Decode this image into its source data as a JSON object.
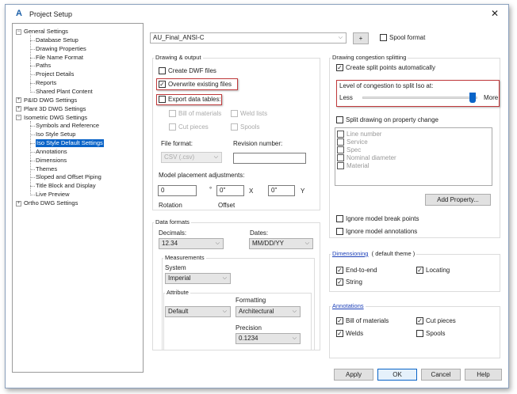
{
  "window": {
    "title": "Project Setup",
    "logo": "A",
    "close": "✕"
  },
  "tree": [
    {
      "label": "General Settings",
      "level": 0,
      "expander": "−"
    },
    {
      "label": "Database Setup",
      "level": 1
    },
    {
      "label": "Drawing Properties",
      "level": 1
    },
    {
      "label": "File Name Format",
      "level": 1
    },
    {
      "label": "Paths",
      "level": 1
    },
    {
      "label": "Project Details",
      "level": 1
    },
    {
      "label": "Reports",
      "level": 1
    },
    {
      "label": "Shared Plant Content",
      "level": 1
    },
    {
      "label": "P&ID DWG Settings",
      "level": 0,
      "expander": "+"
    },
    {
      "label": "Plant 3D DWG Settings",
      "level": 0,
      "expander": "+"
    },
    {
      "label": "Isometric DWG Settings",
      "level": 0,
      "expander": "−"
    },
    {
      "label": "Symbols and Reference",
      "level": 1
    },
    {
      "label": "Iso Style Setup",
      "level": 1
    },
    {
      "label": "Iso Style Default Settings",
      "level": 1,
      "selected": true
    },
    {
      "label": "Annotations",
      "level": 1
    },
    {
      "label": "Dimensions",
      "level": 1
    },
    {
      "label": "Themes",
      "level": 1
    },
    {
      "label": "Sloped and Offset Piping",
      "level": 1
    },
    {
      "label": "Title Block and Display",
      "level": 1
    },
    {
      "label": "Live Preview",
      "level": 1
    },
    {
      "label": "Ortho DWG Settings",
      "level": 0,
      "expander": "+"
    }
  ],
  "top": {
    "style": "AU_Final_ANSI-C",
    "plus": "+",
    "spool_format": "Spool format"
  },
  "drawing_output": {
    "title": "Drawing & output",
    "create_dwf": "Create DWF files",
    "overwrite": "Overwrite existing files",
    "export": "Export data tables:",
    "bom": "Bill of materials",
    "weld_lists": "Weld lists",
    "cut_pieces": "Cut pieces",
    "spools": "Spools",
    "file_format_label": "File format:",
    "file_format": "CSV (.csv)",
    "revision_label": "Revision number:",
    "revision": "",
    "model_label": "Model placement adjustments:",
    "rotation": "0",
    "deg": "°",
    "offset_x": "0\"",
    "x": "X",
    "offset_y": "0\"",
    "y": "Y",
    "rotation_label": "Rotation",
    "offset_label": "Offset"
  },
  "data_formats": {
    "title": "Data formats",
    "decimals_label": "Decimals:",
    "decimals": "12.34",
    "dates_label": "Dates:",
    "dates": "MM/DD/YY",
    "measurements": "Measurements",
    "system_label": "System",
    "system": "Imperial",
    "attribute": "Attribute",
    "attr_value": "Default",
    "formatting_label": "Formatting",
    "formatting": "Architectural",
    "precision_label": "Precision",
    "precision": "0.1234"
  },
  "congestion": {
    "title": "Drawing congestion splitting",
    "create_split": "Create split points automatically",
    "level_label": "Level of congestion to split Iso at:",
    "less": "Less",
    "more": "More",
    "level_value": 0.95,
    "split_property": "Split drawing on property change",
    "properties": [
      "Line number",
      "Service",
      "Spec",
      "Nominal diameter",
      "Material"
    ],
    "add_property": "Add Property...",
    "ignore_break": "Ignore model break points",
    "ignore_annotations": "Ignore model annotations"
  },
  "dimensioning": {
    "title": "Dimensioning",
    "theme": "( default theme )",
    "end_to_end": "End-to-end",
    "locating": "Locating",
    "string": "String"
  },
  "annotations": {
    "title": "Annotations",
    "bom": "Bill of materials",
    "cut_pieces": "Cut pieces",
    "welds": "Welds",
    "spools": "Spools"
  },
  "buttons": {
    "apply": "Apply",
    "ok": "OK",
    "cancel": "Cancel",
    "help": "Help"
  }
}
